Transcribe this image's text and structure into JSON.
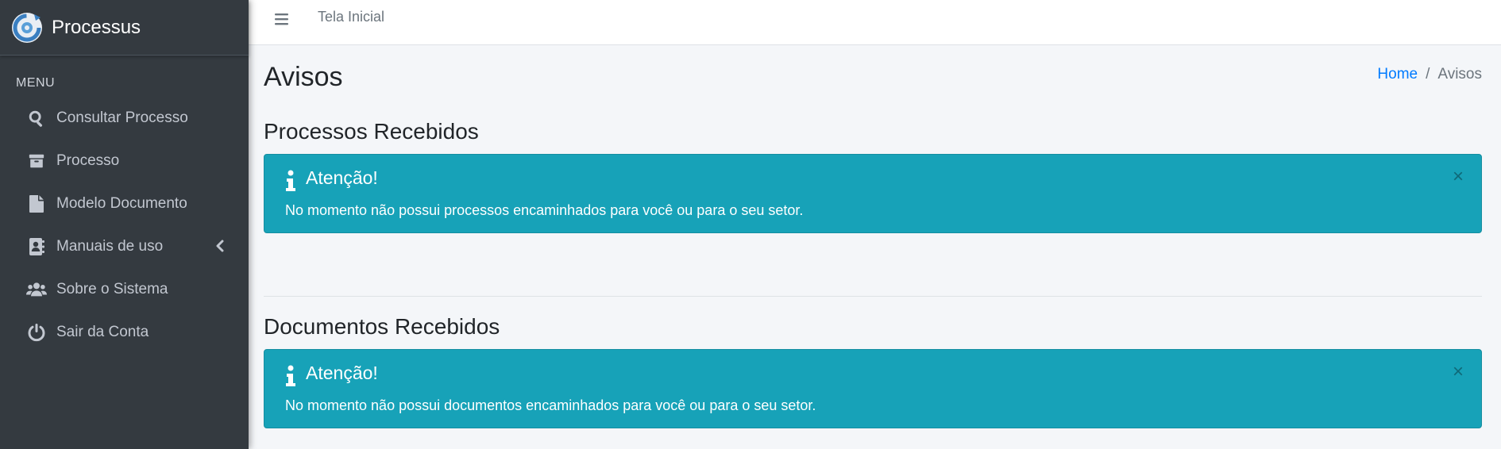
{
  "brand": {
    "name": "Processus"
  },
  "sidebar": {
    "menu_header": "MENU",
    "items": [
      {
        "label": "Consultar Processo",
        "icon": "search-icon"
      },
      {
        "label": "Processo",
        "icon": "archive-icon"
      },
      {
        "label": "Modelo Documento",
        "icon": "file-icon"
      },
      {
        "label": "Manuais de uso",
        "icon": "address-book-icon",
        "has_submenu": true
      },
      {
        "label": "Sobre o Sistema",
        "icon": "users-icon"
      },
      {
        "label": "Sair da Conta",
        "icon": "power-icon"
      }
    ]
  },
  "topbar": {
    "home_link": "Tela Inicial"
  },
  "page": {
    "title": "Avisos",
    "breadcrumb": {
      "home": "Home",
      "separator": "/",
      "current": "Avisos"
    }
  },
  "sections": [
    {
      "title": "Processos Recebidos",
      "alert": {
        "heading": "Atenção!",
        "text": "No momento não possui processos encaminhados para você ou para o seu setor.",
        "close": "×"
      }
    },
    {
      "title": "Documentos Recebidos",
      "alert": {
        "heading": "Atenção!",
        "text": "No momento não possui documentos encaminhados para você ou para o seu setor.",
        "close": "×"
      }
    }
  ],
  "colors": {
    "sidebar_bg": "#343a40",
    "alert_info": "#17a2b8",
    "link": "#007bff",
    "page_bg": "#f4f6f9"
  }
}
